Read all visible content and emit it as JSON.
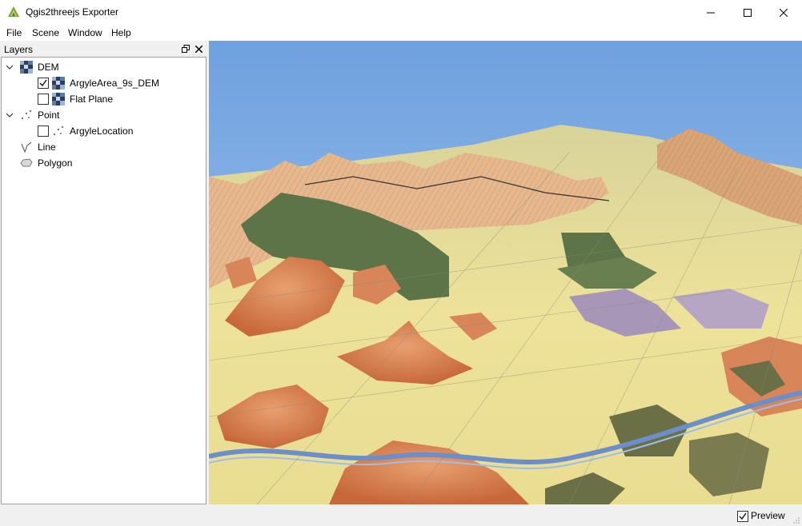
{
  "window": {
    "title": "Qgis2threejs Exporter"
  },
  "menu": [
    {
      "label": "File"
    },
    {
      "label": "Scene"
    },
    {
      "label": "Window"
    },
    {
      "label": "Help"
    }
  ],
  "layers_panel": {
    "title": "Layers",
    "groups": [
      {
        "label": "DEM",
        "expanded": true,
        "icon": "dem-icon",
        "items": [
          {
            "label": "ArgyleArea_9s_DEM",
            "checked": true,
            "icon": "dem-icon"
          },
          {
            "label": "Flat Plane",
            "checked": false,
            "icon": "dem-icon"
          }
        ]
      },
      {
        "label": "Point",
        "expanded": true,
        "icon": "point-icon",
        "items": [
          {
            "label": "ArgyleLocation",
            "checked": false,
            "icon": "point-icon"
          }
        ]
      },
      {
        "label": "Line",
        "expanded": false,
        "icon": "line-icon",
        "items": []
      },
      {
        "label": "Polygon",
        "expanded": false,
        "icon": "polygon-icon",
        "items": []
      }
    ]
  },
  "status": {
    "preview_label": "Preview",
    "preview_checked": true
  },
  "colors": {
    "sky": "#8bb4e6",
    "terrain_orange": "#d98850",
    "terrain_green": "#5d7448",
    "terrain_yellow": "#eee29a",
    "check_accent": "#1a1a1a"
  }
}
